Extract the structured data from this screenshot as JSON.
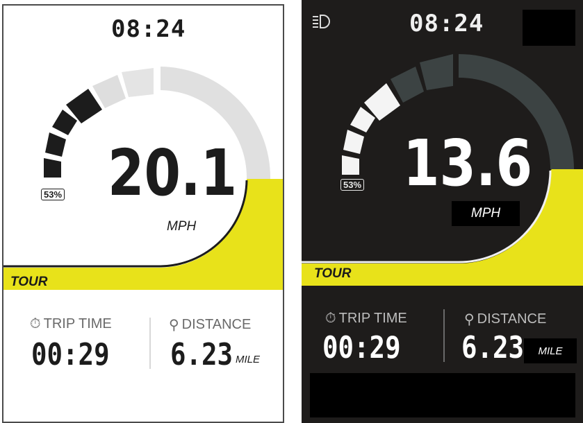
{
  "light": {
    "time": "08:24",
    "battery_percent": "53%",
    "speed": "20.1",
    "speed_unit": "MPH",
    "mode": "TOUR",
    "trip_time_label": "TRIP TIME",
    "trip_time": "00:29",
    "distance_label": "DISTANCE",
    "distance": "6.23",
    "distance_unit": "MILE"
  },
  "dark": {
    "time": "08:24",
    "battery_percent": "53%",
    "speed": "13.6",
    "speed_unit": "MPH",
    "mode": "TOUR",
    "trip_time_label": "TRIP TIME",
    "trip_time": "00:29",
    "distance_label": "DISTANCE",
    "distance": "6.23",
    "distance_unit": "MILE",
    "headlight_icon": "headlight-icon"
  },
  "colors": {
    "accent_yellow": "#e8e21a",
    "dark_bg": "#1e1c1b",
    "light_bg": "#ffffff"
  }
}
